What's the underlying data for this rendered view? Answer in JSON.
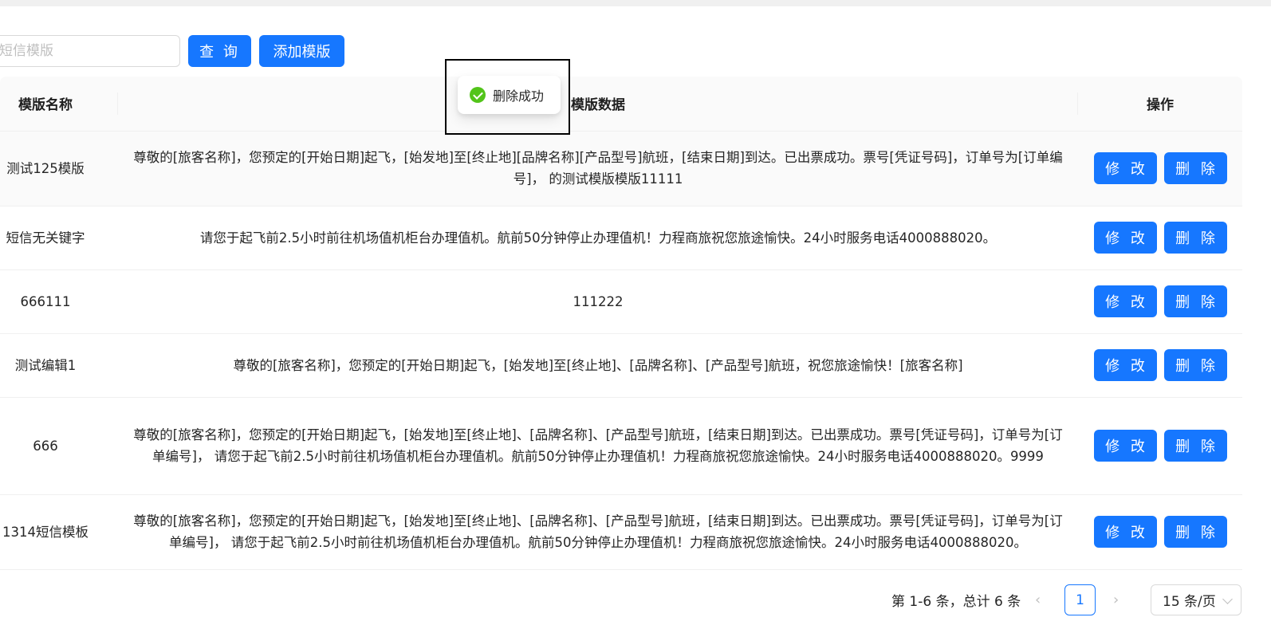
{
  "search": {
    "placeholder": "短信模版",
    "value": ""
  },
  "toolbar": {
    "query_label": "查 询",
    "add_label": "添加模版"
  },
  "table": {
    "columns": [
      "模版名称",
      "模版数据",
      "操作"
    ],
    "edit_label": "修 改",
    "delete_label": "删 除",
    "rows": [
      {
        "name": "测试125模版",
        "data": "尊敬的[旅客名称]，您预定的[开始日期]起飞，[始发地]至[终止地][品牌名称][产品型号]航班，[结束日期]到达。已出票成功。票号[凭证号码]，订单号为[订单编号]， 的测试模版模版11111"
      },
      {
        "name": "短信无关键字",
        "data": "请您于起飞前2.5小时前往机场值机柜台办理值机。航前50分钟停止办理值机！力程商旅祝您旅途愉快。24小时服务电话4000888020。"
      },
      {
        "name": "666111",
        "data": "111222"
      },
      {
        "name": "测试编辑1",
        "data": "尊敬的[旅客名称]，您预定的[开始日期]起飞，[始发地]至[终止地]、[品牌名称]、[产品型号]航班，祝您旅途愉快！[旅客名称]"
      },
      {
        "name": "666",
        "data": "尊敬的[旅客名称]，您预定的[开始日期]起飞，[始发地]至[终止地]、[品牌名称]、[产品型号]航班，[结束日期]到达。已出票成功。票号[凭证号码]，订单号为[订单编号]， 请您于起飞前2.5小时前往机场值机柜台办理值机。航前50分钟停止办理值机！力程商旅祝您旅途愉快。24小时服务电话4000888020。9999"
      },
      {
        "name": "1314短信模板",
        "data": "尊敬的[旅客名称]，您预定的[开始日期]起飞，[始发地]至[终止地]、[品牌名称]、[产品型号]航班，[结束日期]到达。已出票成功。票号[凭证号码]，订单号为[订单编号]， 请您于起飞前2.5小时前往机场值机柜台办理值机。航前50分钟停止办理值机！力程商旅祝您旅途愉快。24小时服务电话4000888020。"
      }
    ]
  },
  "toast": {
    "message": "删除成功",
    "icon": "check-circle-icon",
    "color": "#52c41a"
  },
  "pagination": {
    "total_text": "第 1-6 条，总计 6 条",
    "current_page": "1",
    "page_size": "15 条/页",
    "prev": "‹",
    "next": "›"
  },
  "colors": {
    "primary": "#1677ff",
    "success": "#52c41a"
  }
}
